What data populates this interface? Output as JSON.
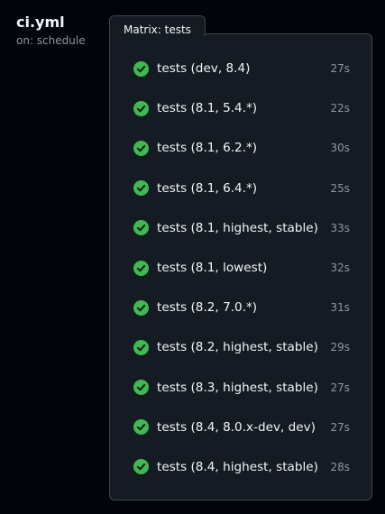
{
  "workflow": {
    "title": "ci.yml",
    "trigger": "on: schedule"
  },
  "matrix": {
    "tab_label": "Matrix: tests",
    "status_color": "#3fb950",
    "jobs": [
      {
        "name": "tests (dev, 8.4)",
        "duration": "27s",
        "status": "success",
        "icon": "check-circle-icon"
      },
      {
        "name": "tests (8.1, 5.4.*)",
        "duration": "22s",
        "status": "success",
        "icon": "check-circle-icon"
      },
      {
        "name": "tests (8.1, 6.2.*)",
        "duration": "30s",
        "status": "success",
        "icon": "check-circle-icon"
      },
      {
        "name": "tests (8.1, 6.4.*)",
        "duration": "25s",
        "status": "success",
        "icon": "check-circle-icon"
      },
      {
        "name": "tests (8.1, highest, stable)",
        "duration": "33s",
        "status": "success",
        "icon": "check-circle-icon"
      },
      {
        "name": "tests (8.1, lowest)",
        "duration": "32s",
        "status": "success",
        "icon": "check-circle-icon"
      },
      {
        "name": "tests (8.2, 7.0.*)",
        "duration": "31s",
        "status": "success",
        "icon": "check-circle-icon"
      },
      {
        "name": "tests (8.2, highest, stable)",
        "duration": "29s",
        "status": "success",
        "icon": "check-circle-icon"
      },
      {
        "name": "tests (8.3, highest, stable)",
        "duration": "27s",
        "status": "success",
        "icon": "check-circle-icon"
      },
      {
        "name": "tests (8.4, 8.0.x-dev, dev)",
        "duration": "27s",
        "status": "success",
        "icon": "check-circle-icon"
      },
      {
        "name": "tests (8.4, highest, stable)",
        "duration": "28s",
        "status": "success",
        "icon": "check-circle-icon"
      }
    ]
  }
}
